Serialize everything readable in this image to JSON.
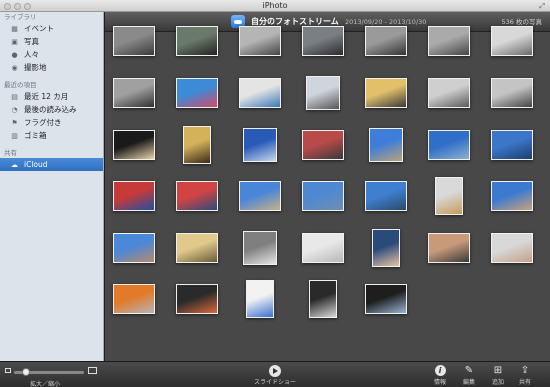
{
  "window": {
    "title": "iPhoto"
  },
  "sidebar": {
    "library_header": "ライブラリ",
    "library_items": [
      {
        "label": "イベント",
        "icon": "events-icon"
      },
      {
        "label": "写真",
        "icon": "photos-icon"
      },
      {
        "label": "人々",
        "icon": "faces-icon"
      },
      {
        "label": "撮影地",
        "icon": "places-icon"
      }
    ],
    "recent_header": "最近の項目",
    "recent_items": [
      {
        "label": "最近 12 カ月",
        "icon": "calendar-icon"
      },
      {
        "label": "最後の読み込み",
        "icon": "import-icon"
      },
      {
        "label": "フラグ付き",
        "icon": "flag-icon"
      },
      {
        "label": "ゴミ箱",
        "icon": "trash-icon"
      }
    ],
    "shared_header": "共有",
    "shared_items": [
      {
        "label": "iCloud",
        "icon": "icloud-icon",
        "selected": true
      }
    ]
  },
  "header": {
    "title": "自分のフォトストリーム",
    "date_range": "2013/09/20 - 2013/10/30",
    "photo_count": "536 枚の写真"
  },
  "photos": [
    {
      "name": "photo-desk",
      "colors": [
        "#8a8a8a",
        "#3a3a3a"
      ]
    },
    {
      "name": "photo-room",
      "colors": [
        "#6a7a6a",
        "#222"
      ]
    },
    {
      "name": "photo-laptop-top",
      "colors": [
        "#b5b5b5",
        "#444"
      ]
    },
    {
      "name": "photo-street",
      "colors": [
        "#7a7f86",
        "#2b2b2b"
      ]
    },
    {
      "name": "photo-hall",
      "colors": [
        "#9a9a9a",
        "#333"
      ]
    },
    {
      "name": "photo-device",
      "colors": [
        "#aaaaaa",
        "#444"
      ]
    },
    {
      "name": "photo-macbook",
      "colors": [
        "#d8d8d8",
        "#6a6a6a"
      ]
    },
    {
      "name": "photo-laptop-closed",
      "colors": [
        "#a0a0a0",
        "#303030"
      ]
    },
    {
      "name": "photo-laptops-colorful",
      "colors": [
        "#3b8bd6",
        "#d34b6b"
      ]
    },
    {
      "name": "photo-ultrabook",
      "colors": [
        "#e4e4e4",
        "#3a78b6"
      ]
    },
    {
      "name": "photo-laptop-screen",
      "colors": [
        "#cfd5dc",
        "#555"
      ]
    },
    {
      "name": "photo-macbook-keyboard",
      "colors": [
        "#e2c06a",
        "#3a3a3a"
      ]
    },
    {
      "name": "photo-thin-laptop",
      "colors": [
        "#cfcfcf",
        "#5a5a5a"
      ]
    },
    {
      "name": "photo-laptop-side",
      "colors": [
        "#c4c4c4",
        "#444"
      ]
    },
    {
      "name": "photo-food",
      "colors": [
        "#1a1a1a",
        "#e8d2a8"
      ]
    },
    {
      "name": "photo-crowd-gold",
      "colors": [
        "#d4b25a",
        "#3a2a1a"
      ]
    },
    {
      "name": "photo-sky-tower",
      "colors": [
        "#2a5ab8",
        "#c9d8ea"
      ]
    },
    {
      "name": "photo-runners",
      "colors": [
        "#b84a4a",
        "#3a3a3a"
      ]
    },
    {
      "name": "photo-beach",
      "colors": [
        "#3f7ed8",
        "#b9a27a"
      ]
    },
    {
      "name": "photo-ocean",
      "colors": [
        "#2f6fc8",
        "#8fb0cf"
      ]
    },
    {
      "name": "photo-sea-horizon",
      "colors": [
        "#3b76c9",
        "#1b3e6e"
      ]
    },
    {
      "name": "photo-bikes",
      "colors": [
        "#c63a3a",
        "#1f4fa0"
      ]
    },
    {
      "name": "photo-bikes-2",
      "colors": [
        "#d24444",
        "#2a4a7a"
      ]
    },
    {
      "name": "photo-shore",
      "colors": [
        "#4a86d8",
        "#c7b089"
      ]
    },
    {
      "name": "photo-bay",
      "colors": [
        "#4f88d2",
        "#6f8fb0"
      ]
    },
    {
      "name": "photo-coast",
      "colors": [
        "#3f7fd0",
        "#2a4a6a"
      ]
    },
    {
      "name": "photo-hand-cup",
      "colors": [
        "#d9d9d9",
        "#c79a5a"
      ]
    },
    {
      "name": "photo-people-park",
      "colors": [
        "#3b7ad0",
        "#c9a27a"
      ]
    },
    {
      "name": "photo-people-2",
      "colors": [
        "#4a88d8",
        "#b58a6a"
      ]
    },
    {
      "name": "photo-cafe",
      "colors": [
        "#e0c98a",
        "#6a5a3a"
      ]
    },
    {
      "name": "photo-keyboard-hand",
      "colors": [
        "#7f7f7f",
        "#e6e6e6"
      ]
    },
    {
      "name": "photo-document",
      "colors": [
        "#e8e8e8",
        "#b8b8b8"
      ]
    },
    {
      "name": "photo-peace-sign",
      "colors": [
        "#2a4a7a",
        "#e6c2a2"
      ]
    },
    {
      "name": "photo-hand-close",
      "colors": [
        "#c89a7a",
        "#3a3a3a"
      ]
    },
    {
      "name": "photo-peace-laptop",
      "colors": [
        "#d8d8d8",
        "#c4a088"
      ]
    },
    {
      "name": "photo-orange-card",
      "colors": [
        "#e27a2a",
        "#b5b5b5"
      ]
    },
    {
      "name": "photo-phone-app",
      "colors": [
        "#2a2a2a",
        "#d96a3a"
      ]
    },
    {
      "name": "photo-app-screen",
      "colors": [
        "#f2f2f2",
        "#3a6fd0"
      ]
    },
    {
      "name": "photo-monitor",
      "colors": [
        "#2a2a2a",
        "#d8d8d8"
      ]
    },
    {
      "name": "photo-tablet",
      "colors": [
        "#1e1e1e",
        "#9ab4d4"
      ]
    }
  ],
  "toolbar": {
    "zoom_label": "拡大／縮小",
    "slideshow_label": "スライドショー",
    "info_label": "情報",
    "edit_label": "編集",
    "add_label": "追加",
    "share_label": "共有"
  }
}
